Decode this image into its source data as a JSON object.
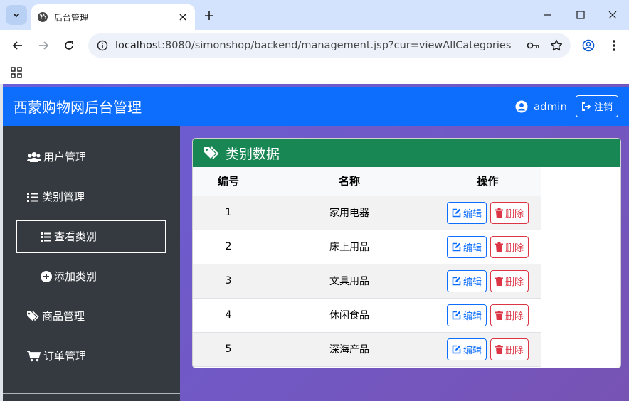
{
  "browser": {
    "tab_title": "后台管理",
    "url_host": "localhost",
    "url_rest": ":8080/simonshop/backend/management.jsp?cur=viewAllCategories"
  },
  "header": {
    "brand": "西蒙购物网后台管理",
    "user": "admin",
    "logout_label": "注销"
  },
  "sidebar": {
    "items": [
      {
        "label": "用户管理",
        "icon": "users-icon"
      },
      {
        "label": "类别管理",
        "icon": "list-icon"
      },
      {
        "label": "查看类别",
        "icon": "list-icon",
        "active": true
      },
      {
        "label": "添加类别",
        "icon": "plus-circle-icon"
      },
      {
        "label": "商品管理",
        "icon": "tags-icon"
      },
      {
        "label": "订单管理",
        "icon": "cart-icon"
      }
    ]
  },
  "panel": {
    "title": "类别数据",
    "columns": [
      "编号",
      "名称",
      "操作"
    ],
    "edit_label": "编辑",
    "delete_label": "删除",
    "rows": [
      {
        "id": "1",
        "name": "家用电器"
      },
      {
        "id": "2",
        "name": "床上用品"
      },
      {
        "id": "3",
        "name": "文具用品"
      },
      {
        "id": "4",
        "name": "休闲食品"
      },
      {
        "id": "5",
        "name": "深海产品"
      }
    ]
  },
  "colors": {
    "header_bg": "#0d6efd",
    "sidebar_bg": "#343a40",
    "panel_head_bg": "#198754",
    "edit": "#0d6efd",
    "delete": "#dc3545"
  }
}
